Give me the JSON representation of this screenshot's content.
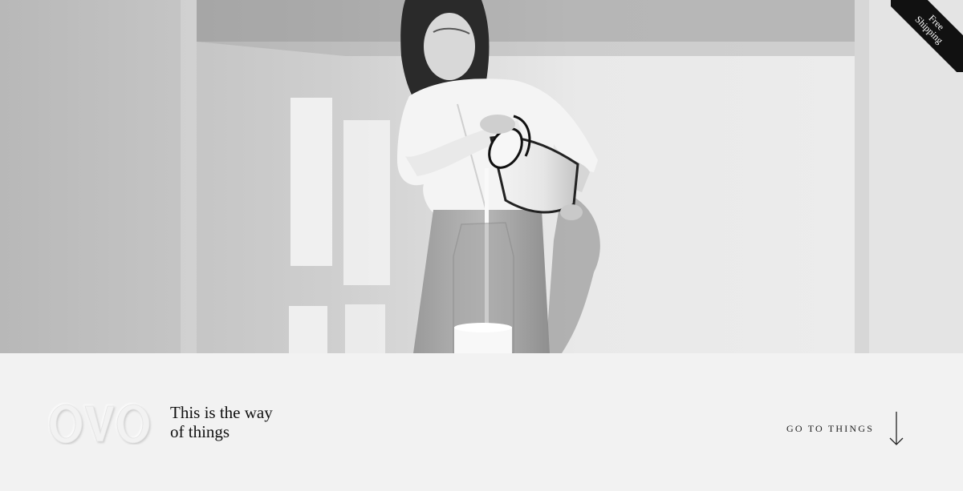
{
  "hero": {
    "image_alt": "Black and white photo of a woman pouring milk from an enamel can into a glass carafe"
  },
  "ribbon": {
    "line1": "Free",
    "line2": "Shipping"
  },
  "brand": {
    "logo_text": "OVO"
  },
  "tagline": {
    "line1": "This is the way",
    "line2": "of things"
  },
  "cta": {
    "label": "GO TO THINGS",
    "icon": "arrow-down-icon"
  },
  "colors": {
    "background": "#f2f2f2",
    "text": "#111111",
    "ribbon": "#111111"
  }
}
